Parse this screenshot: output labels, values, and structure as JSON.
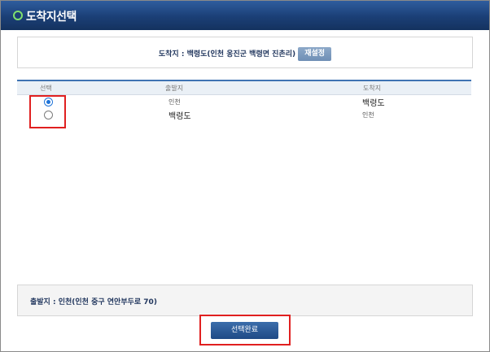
{
  "window": {
    "title": "도착지선택"
  },
  "destination": {
    "label": "도착지 : 백령도(인천 옹진군 백령면 진촌리)",
    "reset_label": "재설정"
  },
  "table": {
    "headers": {
      "select": "선택",
      "from": "출발지",
      "to": "도착지"
    },
    "rows": [
      {
        "selected": true,
        "from": "인천",
        "to": "백령도"
      },
      {
        "selected": false,
        "from": "백령도",
        "to": "인천"
      }
    ]
  },
  "departure": {
    "label": "출발지 : 인천(인천 중구 연안부두로 70)"
  },
  "actions": {
    "done_label": "선택완료"
  },
  "colors": {
    "highlight": "#e02020",
    "titlebar": "#1b3f76",
    "accent": "#3f73b3"
  },
  "icons": {
    "title": "circle-bullet-icon"
  }
}
